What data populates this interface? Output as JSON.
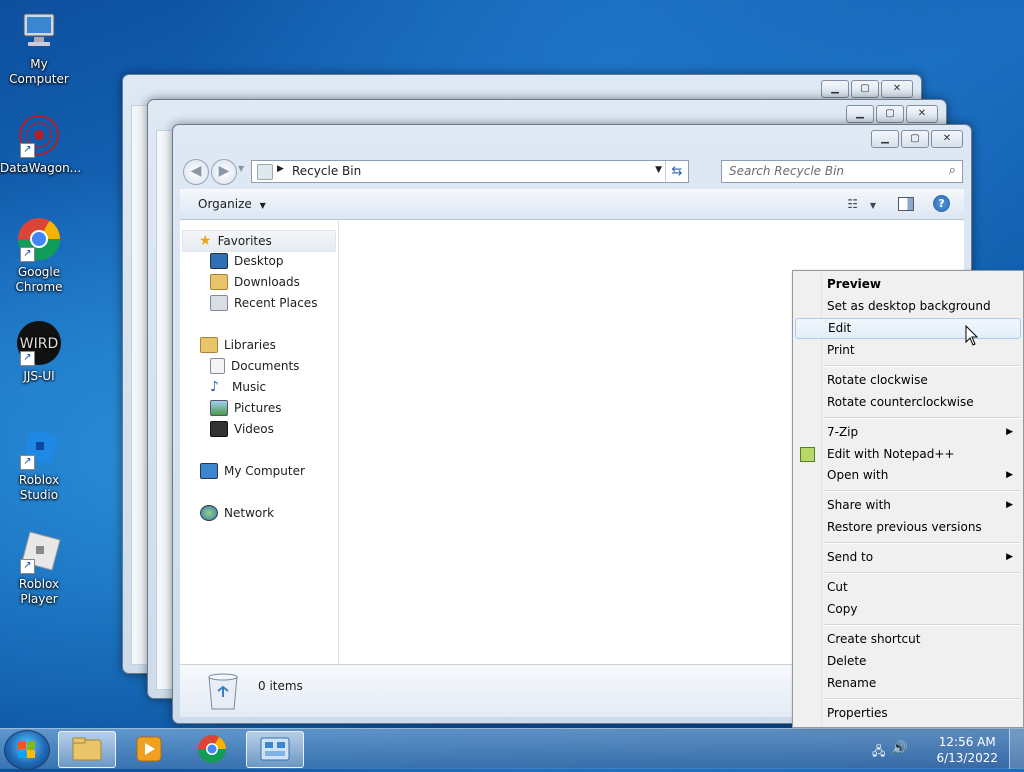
{
  "desktop_icons": [
    {
      "label": "My Computer"
    },
    {
      "label": "DataWagon..."
    },
    {
      "label": "Google Chrome"
    },
    {
      "label": "JJS-UI"
    },
    {
      "label": "Roblox Studio"
    },
    {
      "label": "Roblox Player"
    }
  ],
  "window": {
    "address": "Recycle Bin",
    "search_placeholder": "Search Recycle Bin",
    "organize_label": "Organize",
    "nav": {
      "favorites": "Favorites",
      "desktop": "Desktop",
      "downloads": "Downloads",
      "recent": "Recent Places",
      "libraries": "Libraries",
      "documents": "Documents",
      "music": "Music",
      "pictures": "Pictures",
      "videos": "Videos",
      "computer": "My Computer",
      "network": "Network"
    },
    "status": "0 items"
  },
  "context_menu": {
    "preview": "Preview",
    "set_bg": "Set as desktop background",
    "edit": "Edit",
    "print": "Print",
    "rotate_cw": "Rotate clockwise",
    "rotate_ccw": "Rotate counterclockwise",
    "zip": "7-Zip",
    "notepad": "Edit with Notepad++",
    "open_with": "Open with",
    "share_with": "Share with",
    "restore": "Restore previous versions",
    "send_to": "Send to",
    "cut": "Cut",
    "copy": "Copy",
    "create_shortcut": "Create shortcut",
    "delete": "Delete",
    "rename": "Rename",
    "properties": "Properties"
  },
  "taskbar": {
    "time": "12:56 AM",
    "date": "6/13/2022"
  },
  "icons": {
    "start": "windows-orb-icon",
    "explorer": "folder-icon",
    "media": "media-player-icon",
    "chrome": "chrome-icon",
    "control": "control-panel-icon"
  }
}
